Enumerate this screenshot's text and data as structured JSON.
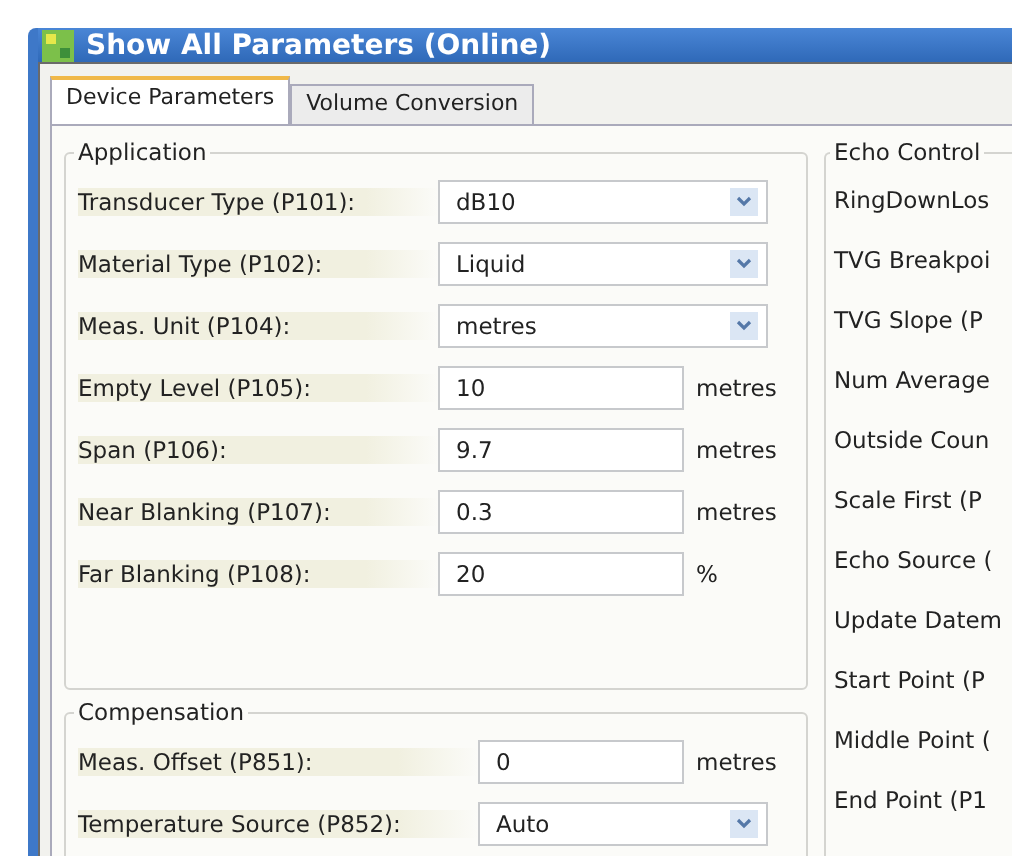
{
  "window": {
    "title": "Show All Parameters (Online)"
  },
  "tabs": [
    {
      "label": "Device Parameters",
      "selected": true
    },
    {
      "label": "Volume Conversion",
      "selected": false
    }
  ],
  "groups": [
    {
      "title": "Application",
      "rows": [
        {
          "label": "Transducer Type (P101):",
          "kind": "dropdown",
          "value": "dB10"
        },
        {
          "label": "Material Type (P102):",
          "kind": "dropdown",
          "value": "Liquid"
        },
        {
          "label": "Meas. Unit (P104):",
          "kind": "dropdown",
          "value": "metres"
        },
        {
          "label": "Empty Level (P105):",
          "kind": "text",
          "value": "10",
          "unit": "metres"
        },
        {
          "label": "Span (P106):",
          "kind": "text",
          "value": "9.7",
          "unit": "metres"
        },
        {
          "label": "Near Blanking (P107):",
          "kind": "text",
          "value": "0.3",
          "unit": "metres"
        },
        {
          "label": "Far Blanking (P108):",
          "kind": "text",
          "value": "20",
          "unit": "%"
        }
      ]
    },
    {
      "title": "Compensation",
      "rows": [
        {
          "label": "Meas. Offset (P851):",
          "kind": "text",
          "value": "0",
          "unit": "metres"
        },
        {
          "label": "Temperature Source (P852):",
          "kind": "dropdown",
          "value": "Auto"
        }
      ]
    }
  ],
  "echo_control": {
    "title": "Echo Control",
    "items": [
      "RingDownLos",
      "TVG Breakpoi",
      "TVG Slope (P",
      "Num Average",
      "Outside Coun",
      "Scale First (P",
      "Echo Source (",
      "Update Datem",
      "Start Point (P",
      "Middle Point (",
      "End Point (P1"
    ]
  }
}
